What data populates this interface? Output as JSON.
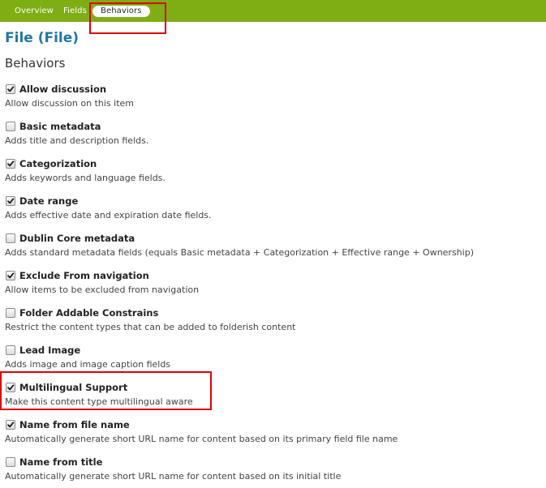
{
  "tabs": [
    {
      "label": "Overview",
      "active": false
    },
    {
      "label": "Fields",
      "active": false
    },
    {
      "label": "Behaviors",
      "active": true
    }
  ],
  "page_title": "File (File)",
  "section_title": "Behaviors",
  "behaviors": [
    {
      "label": "Allow discussion",
      "description": "Allow discussion on this item",
      "checked": true
    },
    {
      "label": "Basic metadata",
      "description": "Adds title and description fields.",
      "checked": false
    },
    {
      "label": "Categorization",
      "description": "Adds keywords and language fields.",
      "checked": true
    },
    {
      "label": "Date range",
      "description": "Adds effective date and expiration date fields.",
      "checked": true
    },
    {
      "label": "Dublin Core metadata",
      "description": "Adds standard metadata fields (equals Basic metadata + Categorization + Effective range + Ownership)",
      "checked": false
    },
    {
      "label": "Exclude From navigation",
      "description": "Allow items to be excluded from navigation",
      "checked": true
    },
    {
      "label": "Folder Addable Constrains",
      "description": "Restrict the content types that can be added to folderish content",
      "checked": false
    },
    {
      "label": "Lead Image",
      "description": "Adds image and image caption fields",
      "checked": false
    },
    {
      "label": "Multilingual Support",
      "description": "Make this content type multilingual aware",
      "checked": true
    },
    {
      "label": "Name from file name",
      "description": "Automatically generate short URL name for content based on its primary field file name",
      "checked": true
    },
    {
      "label": "Name from title",
      "description": "Automatically generate short URL name for content based on its initial title",
      "checked": false
    }
  ],
  "colors": {
    "tabbar": "#7eae13",
    "title": "#1f78a6",
    "highlight": "#e00000"
  }
}
